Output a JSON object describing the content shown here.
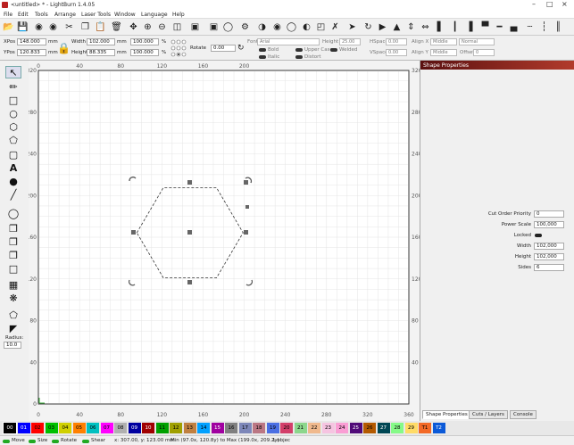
{
  "window": {
    "title": "<untitled> * - LightBurn 1.4.05",
    "controls": [
      "minimize-icon",
      "maximize-icon",
      "close-icon"
    ]
  },
  "menu": [
    "File",
    "Edit",
    "Tools",
    "Arrange",
    "Laser Tools",
    "Window",
    "Language",
    "Help"
  ],
  "toolbar_icons": [
    "open-icon",
    "save-icon",
    "import-icon",
    "export-icon",
    "cut-icon",
    "copy-icon",
    "paste-icon",
    "delete-icon",
    "move-icon",
    "zoom-in-icon",
    "zoom-out-icon",
    "zoom-fit-icon",
    "frame-icon",
    "camera-icon",
    "trace-icon",
    "settings-icon",
    "offset-icon",
    "weld-icon",
    "boolean-union-icon",
    "boolean-subtract-icon",
    "boolean-intersect-icon",
    "send-icon",
    "rotate-icon",
    "mirror-h-icon",
    "mirror-v-icon",
    "group-icon",
    "ungroup-icon",
    "align-left-icon",
    "align-center-icon",
    "align-right-icon",
    "align-top-icon",
    "align-middle-icon",
    "align-bottom-icon",
    "distribute-h-icon",
    "distribute-v-icon"
  ],
  "props": {
    "xpos_label": "XPos",
    "xpos_value": "148.000",
    "ypos_label": "YPos",
    "ypos_value": "120.833",
    "unit": "mm",
    "width_label": "Width",
    "width_value": "102.000",
    "height_label": "Height",
    "height_value": "88.335",
    "scale_w": "100.000",
    "scale_h": "100.000",
    "percent": "%",
    "rotate_label": "Rotate",
    "rotate_value": "0.00",
    "font_label": "Font",
    "font_value": "Arial",
    "fheight_label": "Height",
    "fheight_value": "25.00",
    "hspace_label": "HSpace",
    "hspace_value": "0.00",
    "vspace_label": "VSpace",
    "vspace_value": "0.00",
    "alignx_label": "Align X",
    "alignx_value": "Middle",
    "aligny_label": "Align Y",
    "aligny_value": "Middle",
    "mode_value": "Normal",
    "offset_label": "Offset",
    "offset_value": "0",
    "bold": "Bold",
    "italic": "Italic",
    "uppercase": "Upper Case",
    "distort": "Distort",
    "welded": "Welded"
  },
  "left_tools": [
    "select-icon",
    "edit-nodes-icon",
    "rectangle-icon",
    "ellipse-icon",
    "polygon-icon",
    "pentagon-icon",
    "frame-icon",
    "text-icon",
    "position-laser-icon",
    "measure-icon",
    "offset-icon",
    "copy-along-path-icon",
    "array-icon",
    "grid-array-icon",
    "circular-array-icon",
    "tabs-icon",
    "break-icon"
  ],
  "radius": {
    "label": "Radius:",
    "value": "10.0"
  },
  "ruler": {
    "x_ticks": [
      "0",
      "40",
      "80",
      "120",
      "160",
      "200",
      "240",
      "280",
      "320",
      "360"
    ],
    "y_ticks": [
      "320",
      "280",
      "240",
      "200",
      "160",
      "120",
      "80",
      "40",
      "0"
    ],
    "top_labels": [
      "0",
      "40",
      "80",
      "120",
      "160",
      "200"
    ],
    "right_labels": [
      "320",
      "280",
      "240",
      "200",
      "160",
      "120",
      "80",
      "40"
    ]
  },
  "shape_properties": {
    "title": "Shape Properties",
    "rows": [
      {
        "label": "Cut Order Priority",
        "value": "0"
      },
      {
        "label": "Power Scale",
        "value": "100,000"
      },
      {
        "label": "Locked",
        "value": ""
      },
      {
        "label": "Width",
        "value": "102,000"
      },
      {
        "label": "Height",
        "value": "102,000"
      },
      {
        "label": "Sides",
        "value": "6"
      }
    ]
  },
  "tabs": [
    "Shape Properties",
    "Cuts / Layers",
    "Console"
  ],
  "palette": [
    {
      "label": "00",
      "color": "#000000",
      "fg": "#ffffff"
    },
    {
      "label": "01",
      "color": "#0000ff",
      "fg": "#ffffff"
    },
    {
      "label": "02",
      "color": "#ff0000",
      "fg": "#000000"
    },
    {
      "label": "03",
      "color": "#00c000",
      "fg": "#000000"
    },
    {
      "label": "04",
      "color": "#d0d000",
      "fg": "#000000"
    },
    {
      "label": "05",
      "color": "#ff8000",
      "fg": "#000000"
    },
    {
      "label": "06",
      "color": "#00c0c0",
      "fg": "#000000"
    },
    {
      "label": "07",
      "color": "#ff00ff",
      "fg": "#000000"
    },
    {
      "label": "08",
      "color": "#b0b0b0",
      "fg": "#000000"
    },
    {
      "label": "09",
      "color": "#0000a0",
      "fg": "#ffffff"
    },
    {
      "label": "10",
      "color": "#a00000",
      "fg": "#ffffff"
    },
    {
      "label": "11",
      "color": "#00a000",
      "fg": "#000000"
    },
    {
      "label": "12",
      "color": "#a0a000",
      "fg": "#000000"
    },
    {
      "label": "13",
      "color": "#c08040",
      "fg": "#000000"
    },
    {
      "label": "14",
      "color": "#00a0ff",
      "fg": "#000000"
    },
    {
      "label": "15",
      "color": "#a000a0",
      "fg": "#ffffff"
    },
    {
      "label": "16",
      "color": "#808080",
      "fg": "#000000"
    },
    {
      "label": "17",
      "color": "#7d87b9",
      "fg": "#000000"
    },
    {
      "label": "18",
      "color": "#bb7784",
      "fg": "#000000"
    },
    {
      "label": "19",
      "color": "#4a6fe3",
      "fg": "#000000"
    },
    {
      "label": "20",
      "color": "#d33f6a",
      "fg": "#000000"
    },
    {
      "label": "21",
      "color": "#8cd78c",
      "fg": "#000000"
    },
    {
      "label": "22",
      "color": "#f0b98d",
      "fg": "#000000"
    },
    {
      "label": "23",
      "color": "#f6c4e1",
      "fg": "#000000"
    },
    {
      "label": "24",
      "color": "#fa9ed4",
      "fg": "#000000"
    },
    {
      "label": "25",
      "color": "#500a78",
      "fg": "#ffffff"
    },
    {
      "label": "26",
      "color": "#b45a00",
      "fg": "#000000"
    },
    {
      "label": "27",
      "color": "#004754",
      "fg": "#ffffff"
    },
    {
      "label": "28",
      "color": "#86fa88",
      "fg": "#000000"
    },
    {
      "label": "29",
      "color": "#ffdb66",
      "fg": "#000000"
    },
    {
      "label": "T1",
      "color": "#f36926",
      "fg": "#000000"
    },
    {
      "label": "T2",
      "color": "#0c5ad8",
      "fg": "#ffffff"
    }
  ],
  "status": {
    "move": "Move",
    "size": "Size",
    "rotate": "Rotate",
    "shear": "Shear",
    "coords": "x: 307.00, y: 123.00 mm",
    "bounds": "Min (97.0x, 120.8y) to Max (199.0x, 209.2y)",
    "count": "1 objec"
  }
}
